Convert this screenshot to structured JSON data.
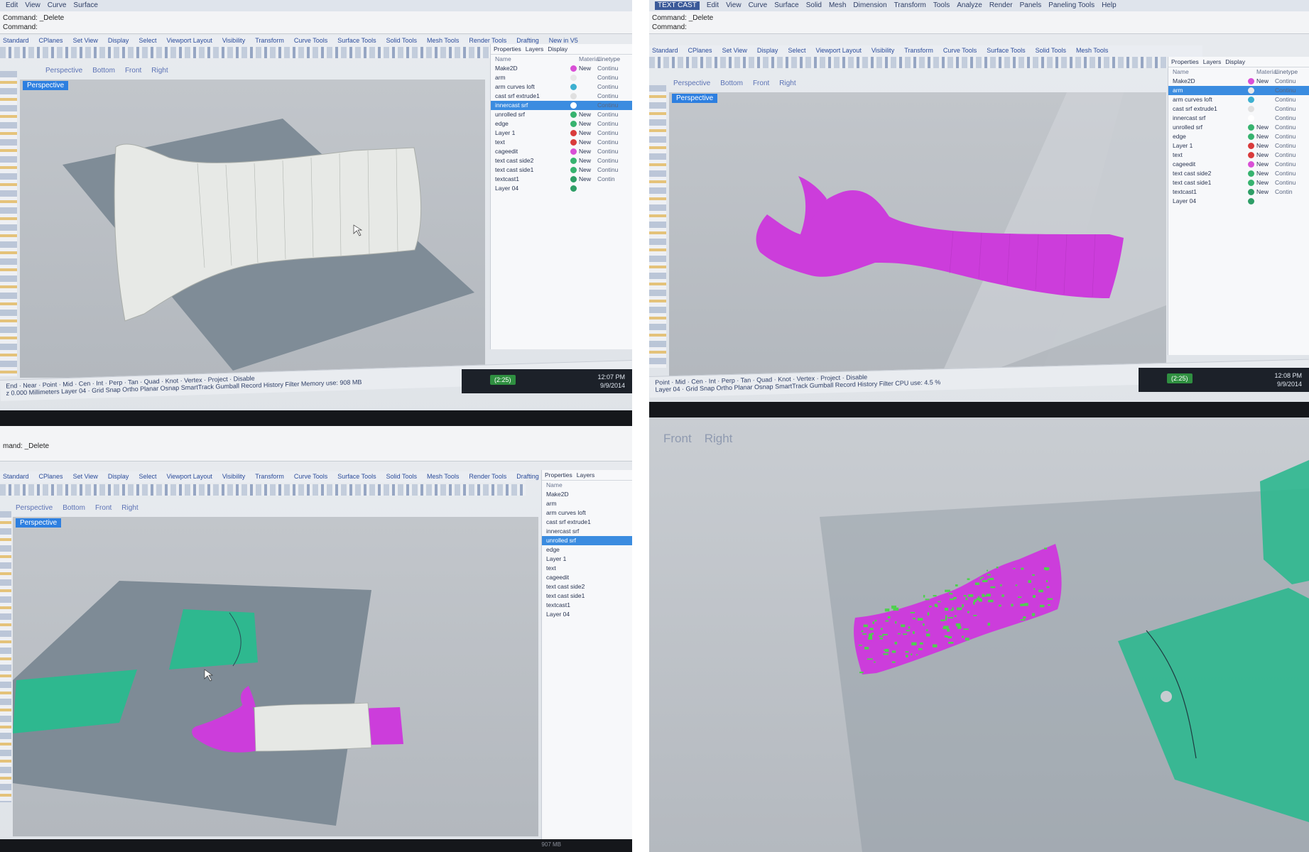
{
  "menu": [
    "Edit",
    "View",
    "Curve",
    "Surface",
    "Solid",
    "Mesh",
    "Dimension",
    "Transform",
    "Tools",
    "Analyze",
    "Render",
    "Panels",
    "Paneling Tools",
    "Help"
  ],
  "q2_title_text": "TEXT CAST",
  "command": {
    "label": "Command:",
    "value": "_Delete"
  },
  "q3_command_label": "mand:",
  "toolbar_tabs": [
    "Standard",
    "CPlanes",
    "Set View",
    "Display",
    "Select",
    "Viewport Layout",
    "Visibility",
    "Transform",
    "Curve Tools",
    "Surface Tools",
    "Solid Tools",
    "Mesh Tools",
    "Render Tools",
    "Drafting",
    "New in V5"
  ],
  "view_tabs": [
    "Perspective",
    "Bottom",
    "Front",
    "Right"
  ],
  "q4_view_tabs": [
    "Front",
    "Right"
  ],
  "viewport_label": "Perspective",
  "panel_tabs": [
    "Properties",
    "Layers",
    "Display"
  ],
  "layers_headers": {
    "name": "Name",
    "material": "Material",
    "linetype": "Linetype"
  },
  "layers": [
    {
      "name": "Make2D",
      "material": "New",
      "linetype": "Continu"
    },
    {
      "name": "arm",
      "material": "",
      "linetype": "Continu"
    },
    {
      "name": "arm curves loft",
      "material": "",
      "linetype": "Continu"
    },
    {
      "name": "cast srf extrude1",
      "material": "",
      "linetype": "Continu"
    },
    {
      "name": "innercast srf",
      "material": "",
      "linetype": "Continu"
    },
    {
      "name": "unrolled srf",
      "material": "New",
      "linetype": "Continu"
    },
    {
      "name": "edge",
      "material": "New",
      "linetype": "Continu"
    },
    {
      "name": "Layer 1",
      "material": "New",
      "linetype": "Continu"
    },
    {
      "name": "text",
      "material": "New",
      "linetype": "Continu"
    },
    {
      "name": "cageedit",
      "material": "New",
      "linetype": "Continu"
    },
    {
      "name": "text cast side2",
      "material": "New",
      "linetype": "Continu"
    },
    {
      "name": "text cast side1",
      "material": "New",
      "linetype": "Continu"
    },
    {
      "name": "textcast1",
      "material": "New",
      "linetype": "Contin"
    },
    {
      "name": "Layer 04",
      "material": "",
      "linetype": ""
    }
  ],
  "layer_colors": [
    "#d94fd6",
    "#e8e8e8",
    "#3db0d0",
    "#e0e0e0",
    "#ffffff",
    "#37b36f",
    "#37b36f",
    "#d93b3b",
    "#d93b3b",
    "#d94fd6",
    "#37b36f",
    "#37b36f",
    "#2e9e66",
    "#2e9e66"
  ],
  "status": {
    "osnap": [
      "End",
      "Near",
      "Point",
      "Mid",
      "Cen",
      "Int",
      "Perp",
      "Tan",
      "Quad",
      "Knot",
      "Vertex",
      "Project",
      "Disable"
    ],
    "toggles": [
      "Grid Snap",
      "Ortho",
      "Planar",
      "Osnap",
      "SmartTrack",
      "Gumball",
      "Record History",
      "Filter"
    ],
    "units": "Millimeters",
    "layer": "Layer 04",
    "memory": "Memory use: 908 MB",
    "cpu": "CPU use: 4.5 %",
    "q3_memory": "907 MB",
    "coords": "z 0.000"
  },
  "clock1": {
    "time": "12:07 PM",
    "date": "9/9/2014"
  },
  "clock2": {
    "time": "12:08 PM",
    "date": "9/9/2014"
  },
  "counter": "(2:25)",
  "colors": {
    "accent": "#2d7fe0",
    "magenta": "#cc3ddb",
    "green": "#2eb88f",
    "plane": "#7e8b96"
  }
}
